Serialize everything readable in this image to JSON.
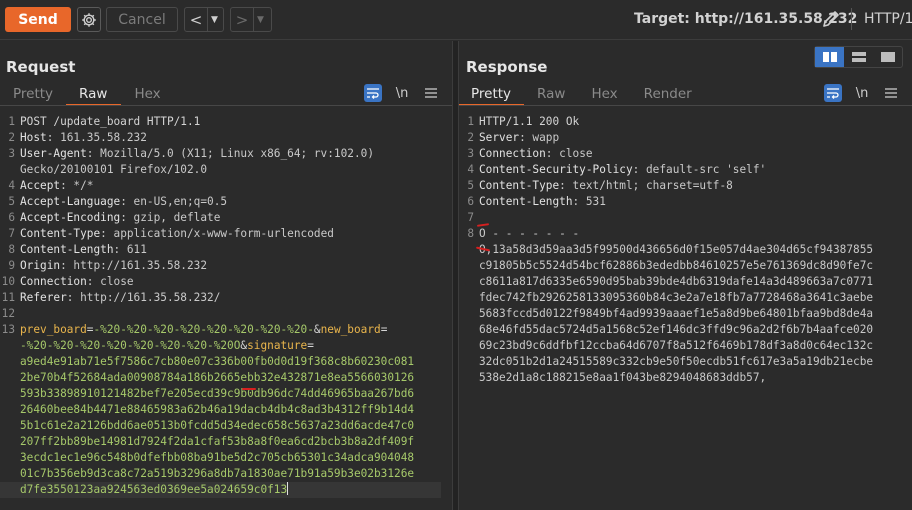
{
  "toolbar": {
    "send_label": "Send",
    "cancel_label": "Cancel",
    "back_label": "<",
    "forward_label": ">",
    "target_label": "Target: http://161.35.58.232",
    "http_version": "HTTP/1"
  },
  "colors": {
    "accent": "#e8672a",
    "selected_blue": "#3a74c4",
    "param_name": "#e9b54c",
    "param_value": "#a6c96a",
    "annotation_red": "#d62020"
  },
  "request": {
    "title": "Request",
    "tabs": [
      "Pretty",
      "Raw",
      "Hex"
    ],
    "active_tab": "Raw",
    "tool_icons": {
      "wrap": "≡",
      "newline": "\\n",
      "menu": "≡"
    },
    "lines": {
      "l1": "POST /update_board HTTP/1.1",
      "l2_name": "Host",
      "l2_value": ": 161.35.58.232",
      "l3_name": "User-Agent",
      "l3_value": ": Mozilla/5.0 (X11; Linux x86_64; rv:102.0)",
      "l3_wrap": "Gecko/20100101 Firefox/102.0",
      "l4_name": "Accept",
      "l4_value": ": */*",
      "l5_name": "Accept-Language",
      "l5_value": ": en-US,en;q=0.5",
      "l6_name": "Accept-Encoding",
      "l6_value": ": gzip, deflate",
      "l7_name": "Content-Type",
      "l7_value": ": application/x-www-form-urlencoded",
      "l8_name": "Content-Length",
      "l8_value": ": 611",
      "l9_name": "Origin",
      "l9_value": ": http://161.35.58.232",
      "l10_name": "Connection",
      "l10_value": ": close",
      "l11_name": "Referer",
      "l11_value": ": http://161.35.58.232/",
      "b1_name": "prev_board",
      "b1_eq": "=",
      "b1_value": "-%20-%20-%20-%20-%20-%20-%20-%20-",
      "b1_amp": "&",
      "b1_name2": "new_board",
      "b1_eq2": "=",
      "b2_value": "-%20-%20-%20-%20-%20-%20-%20-%20O",
      "b2_amp": "&",
      "b2_name": "signature",
      "b2_eq": "=",
      "sig": [
        "a9ed4e91ab71e5f7586c7cb80e07c336b00fb0d0d19f368c8b60230c081",
        "2be70b4f52684ada00908784a186b2665ebb32e432871e8ea5566030126",
        "593b33898910121482bef7e205ecd39c9b0db96dc74dd46965baa267bd6",
        "26460bee84b4471e88465983a62b46a19dacb4db4c8ad3b4312ff9b14d4",
        "5b1c61e2a2126bdd6ae0513b0fcdd5d34edec658c5637a23dd6acde47c0",
        "207ff2bb89be14981d7924f2da1cfaf53b8a8f0ea6cd2bcb3b8a2df409f",
        "3ecdc1ec1e96c548b0dfefbb08ba91be5d2c705cb65301c34adca904048",
        "01c7b356eb9d3ca8c72a519b3296a8db7a1830ae71b91a59b3e02b3126e",
        "d7fe3550123aa924563ed0369ee5a024659c0f13"
      ]
    }
  },
  "response": {
    "title": "Response",
    "tabs": [
      "Pretty",
      "Raw",
      "Hex",
      "Render"
    ],
    "active_tab": "Pretty",
    "tool_icons": {
      "wrap": "≡",
      "newline": "\\n",
      "menu": "≡"
    },
    "lines": {
      "l1": "HTTP/1.1 200 Ok",
      "l2_name": "Server",
      "l2_value": ": wapp",
      "l3_name": "Connection",
      "l3_value": ": close",
      "l4_name": "Content-Security-Policy",
      "l4_value": ": default-src 'self'",
      "l5_name": "Content-Type",
      "l5_value": ": text/html; charset=utf-8",
      "l6_name": "Content-Length",
      "l6_value": ": 531",
      "l8": "O - - - - - - -",
      "body": [
        "O,13a58d3d59aa3d5f99500d436656d0f15e057d4ae304d65cf94387855",
        "c91805b5c5524d54bcf62886b3ededbb84610257e5e761369dc8d90fe7c",
        "c8611a817d6335e6590d95bab39bde4db6319dafe14a3d489663a7c0771",
        "fdec742fb2926258133095360b84c3e2a7e18fb7a7728468a3641c3aebe",
        "5683fccd5d0122f9849bf4ad9939aaaef1e5a8d9be64801bfaa9bd8de4a",
        "68e46fd55dac5724d5a1568c52ef146dc3ffd9c96a2d2f6b7b4aafce020",
        "69c23bd9c6ddfbf12ccba64d6707f8a512f6469b178df3a8d0c64ec132c",
        "32dc051b2d1a24515589c332cb9e50f50ecdb51fc617e3a5a19db21ecbe",
        "538e2d1a8c188215e8aa1f043be8294048683ddb57,"
      ]
    }
  }
}
